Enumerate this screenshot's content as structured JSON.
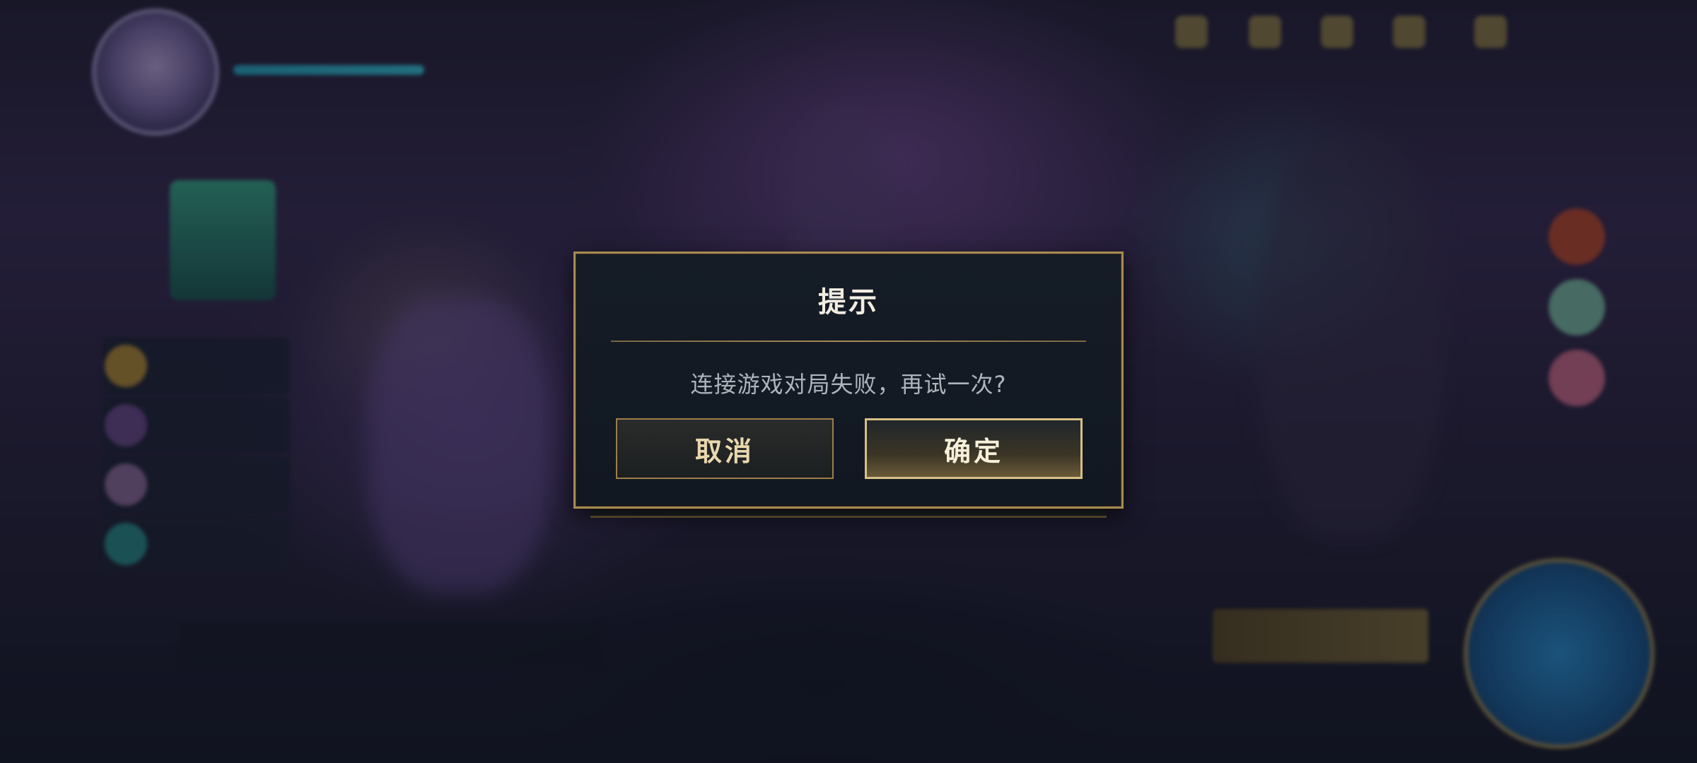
{
  "dialog": {
    "title": "提示",
    "message": "连接游戏对局失败，再试一次?",
    "cancel_label": "取消",
    "confirm_label": "确定"
  },
  "colors": {
    "dialog_bg": "#131a23",
    "dialog_border": "#a88a4f",
    "cancel_text": "#e9d8ae",
    "confirm_border": "#d8bf86"
  },
  "background_icons": {
    "avatar": "player-avatar",
    "play": "play-button-orb"
  }
}
